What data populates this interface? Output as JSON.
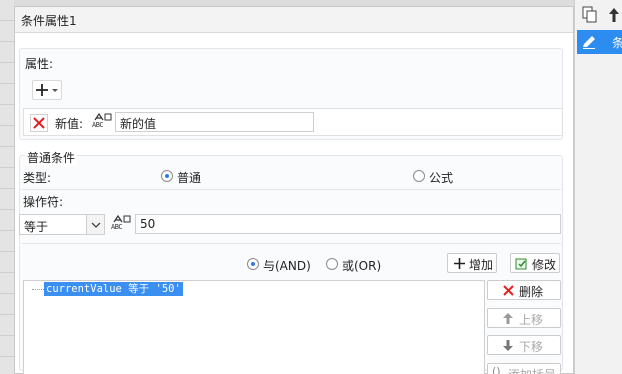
{
  "dialog": {
    "title": "条件属性1"
  },
  "properties": {
    "section_label": "属性:",
    "add_button_label": "+"
  },
  "new_value": {
    "label": "新值:",
    "value": "新的值"
  },
  "normal_condition": {
    "section_label": "普通条件",
    "type_label": "类型:",
    "type_options": [
      {
        "label": "普通",
        "selected": true
      },
      {
        "label": "公式",
        "selected": false
      }
    ],
    "operator_label": "操作符:",
    "operator_value": "等于",
    "operand_value": "50"
  },
  "logic": {
    "and_label": "与(AND)",
    "and_selected": true,
    "or_label": "或(OR)",
    "or_selected": false
  },
  "buttons": {
    "add": "增加",
    "modify": "修改",
    "delete": "删除",
    "move_up": "上移",
    "move_down": "下移",
    "add_bracket": "添加括号"
  },
  "condition_list": [
    "currentValue 等于 '50'"
  ],
  "side_panel": {
    "row_label": "条"
  },
  "colors": {
    "accent": "#2d8cf0",
    "selection": "#3b8ff0",
    "delete_red": "#e02020"
  }
}
